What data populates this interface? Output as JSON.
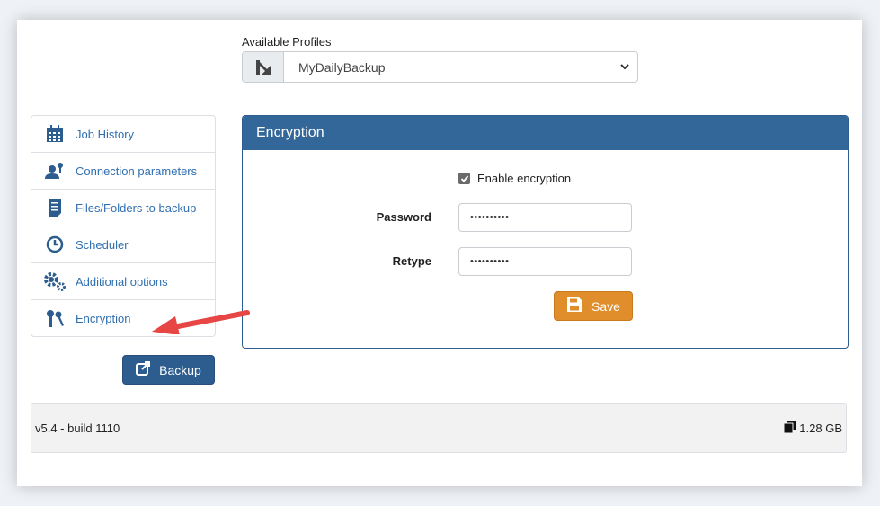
{
  "profile": {
    "label": "Available Profiles",
    "selected": "MyDailyBackup",
    "icon": "profile-edit-icon"
  },
  "sidebar": {
    "items": [
      {
        "label": "Job History",
        "icon": "calendar-icon"
      },
      {
        "label": "Connection parameters",
        "icon": "user-key-icon"
      },
      {
        "label": "Files/Folders to backup",
        "icon": "file-icon"
      },
      {
        "label": "Scheduler",
        "icon": "clock-icon"
      },
      {
        "label": "Additional options",
        "icon": "gears-icon"
      },
      {
        "label": "Encryption",
        "icon": "keys-icon"
      }
    ]
  },
  "backup_button": {
    "label": "Backup",
    "icon": "external-link-icon"
  },
  "panel": {
    "title": "Encryption",
    "enable_label": "Enable encryption",
    "enable_checked": true,
    "password_label": "Password",
    "password_value": "••••••••••",
    "retype_label": "Retype",
    "retype_value": "••••••••••",
    "save_label": "Save"
  },
  "footer": {
    "version": "v5.4 - build 1110",
    "storage": "1.28 GB",
    "storage_icon": "copy-icon"
  },
  "colors": {
    "primary": "#336699",
    "link": "#2f6fb0",
    "save": "#e08e2b",
    "arrow": "#e84545"
  }
}
